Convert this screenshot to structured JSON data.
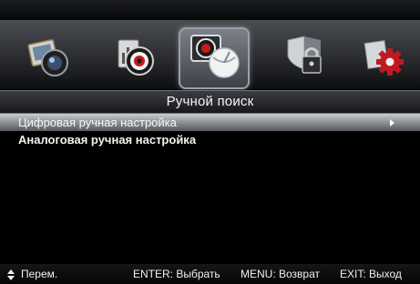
{
  "colors": {
    "background": "#000000",
    "highlight": "#8d9096",
    "text": "#f2f2f2"
  },
  "icons": [
    {
      "name": "picture-icon",
      "selected": false
    },
    {
      "name": "sound-icon",
      "selected": false
    },
    {
      "name": "channel-icon",
      "selected": true
    },
    {
      "name": "lock-icon",
      "selected": false
    },
    {
      "name": "setup-icon",
      "selected": false
    }
  ],
  "menu": {
    "title": "Ручной поиск",
    "items": [
      {
        "label": "Цифровая ручная настройка",
        "selected": true
      },
      {
        "label": "Аналоговая ручная настройка",
        "selected": false
      }
    ]
  },
  "status": {
    "move": "Перем.",
    "enter": "ENTER: Выбрать",
    "menu": "MENU: Возврат",
    "exit": "EXIT: Выход"
  }
}
